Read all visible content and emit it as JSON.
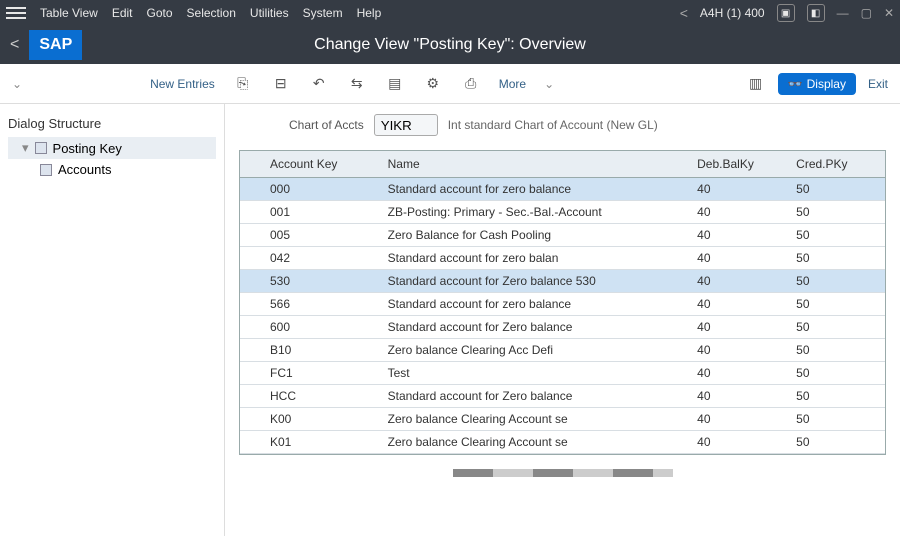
{
  "menubar": {
    "items": [
      "Table View",
      "Edit",
      "Goto",
      "Selection",
      "Utilities",
      "System",
      "Help"
    ],
    "status": "A4H (1) 400"
  },
  "titlebar": {
    "logo": "SAP",
    "title": "Change View \"Posting Key\": Overview"
  },
  "toolbar": {
    "new_entries": "New Entries",
    "more": "More",
    "display": "Display",
    "exit": "Exit"
  },
  "sidebar": {
    "header": "Dialog Structure",
    "items": [
      {
        "label": "Posting Key",
        "selected": true
      },
      {
        "label": "Accounts",
        "selected": false
      }
    ]
  },
  "filter": {
    "label": "Chart of Accts",
    "value": "YIKR",
    "desc": "Int standard Chart of Account (New GL)"
  },
  "table": {
    "headers": {
      "act": "Account Key",
      "name": "Name",
      "dkey": "Deb.BalKy",
      "ckey": "Cred.PKy"
    },
    "rows": [
      {
        "act": "000",
        "name": "Standard account for zero balance",
        "d": "40",
        "c": "50",
        "sel": true
      },
      {
        "act": "001",
        "name": "ZB-Posting: Primary - Sec.-Bal.-Account",
        "d": "40",
        "c": "50"
      },
      {
        "act": "005",
        "name": "Zero Balance for Cash Pooling",
        "d": "40",
        "c": "50"
      },
      {
        "act": "042",
        "name": "Standard account for zero balan",
        "d": "40",
        "c": "50"
      },
      {
        "act": "530",
        "name": "Standard account for Zero balance 530",
        "d": "40",
        "c": "50",
        "sel": true
      },
      {
        "act": "566",
        "name": "Standard account for zero balance",
        "d": "40",
        "c": "50"
      },
      {
        "act": "600",
        "name": "Standard account for Zero balance",
        "d": "40",
        "c": "50"
      },
      {
        "act": "B10",
        "name": "Zero balance Clearing Acc Defi",
        "d": "40",
        "c": "50"
      },
      {
        "act": "FC1",
        "name": "Test",
        "d": "40",
        "c": "50"
      },
      {
        "act": "HCC",
        "name": "Standard account for Zero balance",
        "d": "40",
        "c": "50"
      },
      {
        "act": "K00",
        "name": "Zero balance Clearing Account se",
        "d": "40",
        "c": "50"
      },
      {
        "act": "K01",
        "name": "Zero balance Clearing Account se",
        "d": "40",
        "c": "50"
      }
    ]
  }
}
